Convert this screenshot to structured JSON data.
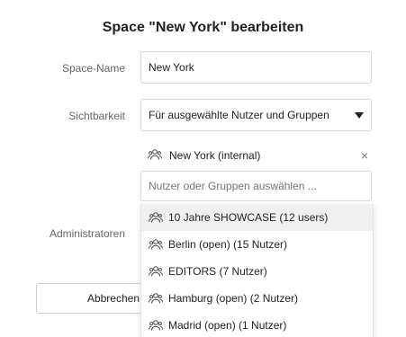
{
  "dialog": {
    "title": "Space \"New York\" bearbeiten"
  },
  "form": {
    "space_name": {
      "label": "Space-Name",
      "value": "New York"
    },
    "visibility": {
      "label": "Sichtbarkeit",
      "selected": "Für ausgewählte Nutzer und Gruppen"
    },
    "selected_groups": [
      {
        "label": "New York (internal)",
        "icon": "group-icon"
      }
    ],
    "remove_symbol": "×",
    "group_search": {
      "placeholder": "Nutzer oder Gruppen auswählen ..."
    },
    "administrators": {
      "label": "Administratoren"
    }
  },
  "dropdown": {
    "items": [
      {
        "label": "10 Jahre SHOWCASE (12 users)",
        "icon": "group-icon",
        "highlighted": true
      },
      {
        "label": "Berlin (open) (15 Nutzer)",
        "icon": "group-icon"
      },
      {
        "label": "EDITORS (7 Nutzer)",
        "icon": "group-icon"
      },
      {
        "label": "Hamburg (open) (2 Nutzer)",
        "icon": "group-icon"
      },
      {
        "label": "Madrid (open) (1 Nutzer)",
        "icon": "group-icon"
      }
    ]
  },
  "buttons": {
    "cancel_label": "Abbrechen"
  },
  "colors": {
    "primary": "#4a86e8",
    "highlight": "#f0f0f0",
    "border": "#d9d9d9"
  }
}
